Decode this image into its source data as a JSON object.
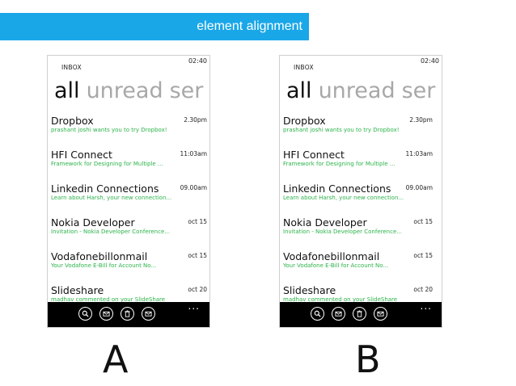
{
  "banner": {
    "title": "element alignment",
    "color": "#1aa7e8"
  },
  "phones": [
    {
      "clock": "02:40",
      "app_title": "INBOX",
      "pivots": [
        "all",
        "unread",
        "ser"
      ],
      "emails": [
        {
          "sender": "Dropbox",
          "preview": "prashant joshi wants you to try Dropbox!",
          "time": "2.30pm"
        },
        {
          "sender": "HFI Connect",
          "preview": "Framework for Designing for Multiple ...",
          "time": "11:03am"
        },
        {
          "sender": "Linkedin Connections",
          "preview": "Learn about Harsh, your new connection...",
          "time": "09.00am"
        },
        {
          "sender": "Nokia Developer",
          "preview": "Invitation - Nokia Developer Conference...",
          "time": "oct 15"
        },
        {
          "sender": "Vodafonebillonmail",
          "preview": "Your Vodafone E-Bill for Account No...",
          "time": "oct 15"
        },
        {
          "sender": "Slideshare",
          "preview": "madhav commented on your SlideShare",
          "time": "oct 20"
        }
      ],
      "appbar_icons": [
        "search-icon",
        "mail-icon",
        "delete-icon",
        "compose-icon"
      ],
      "more": "...",
      "label": "A"
    },
    {
      "clock": "02:40",
      "app_title": "INBOX",
      "pivots": [
        "all",
        "unread",
        "ser"
      ],
      "emails": [
        {
          "sender": "Dropbox",
          "preview": "prashant joshi wants you to try Dropbox!",
          "time": "2.30pm"
        },
        {
          "sender": "HFI Connect",
          "preview": "Framework for Designing for Multiple ...",
          "time": "11:03am"
        },
        {
          "sender": "Linkedin Connections",
          "preview": "Learn about Harsh, your new connection...",
          "time": "09.00am"
        },
        {
          "sender": "Nokia Developer",
          "preview": "Invitation - Nokia Developer Conference...",
          "time": "oct 15"
        },
        {
          "sender": "Vodafonebillonmail",
          "preview": "Your Vodafone E-Bill for Account No...",
          "time": "oct 15"
        },
        {
          "sender": "Slideshare",
          "preview": "madhav commented on your SlideShare",
          "time": "oct 20"
        }
      ],
      "appbar_icons": [
        "search-icon",
        "mail-icon",
        "delete-icon",
        "compose-icon"
      ],
      "more": "...",
      "label": "B"
    }
  ],
  "colors": {
    "preview_text": "#2cb34a",
    "pivot_inactive": "#a8a8a8",
    "appbar": "#000000"
  }
}
